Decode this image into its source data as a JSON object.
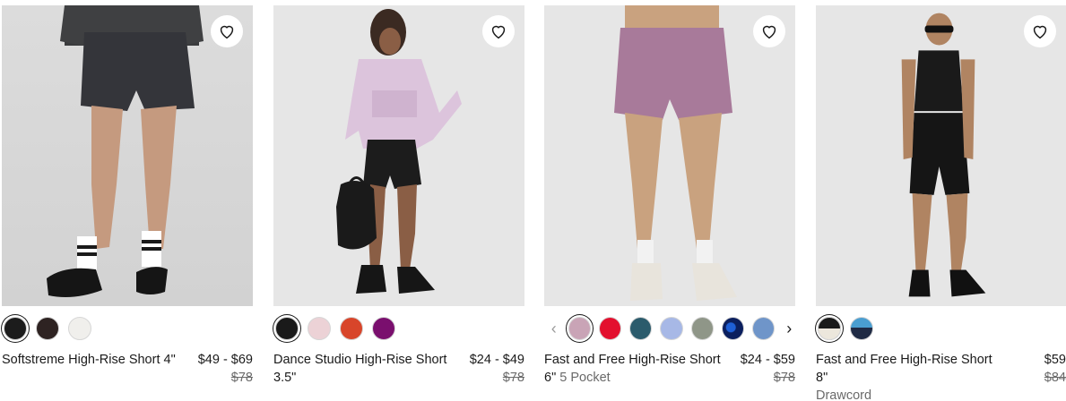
{
  "products": [
    {
      "name": "Softstreme High-Rise Short 4\"",
      "subtitle": "",
      "price": "$49 - $69",
      "original_price": "$78",
      "swatches": [
        "#1c1c1c",
        "#2e2322",
        "#f0efec"
      ],
      "selected_swatch": 0
    },
    {
      "name": "Dance Studio High-Rise Short 3.5\"",
      "subtitle": "",
      "price": "$24 - $49",
      "original_price": "$78",
      "swatches": [
        "#1a1a1a",
        "#ecd2d6",
        "#d8452a",
        "#7a0f6e"
      ],
      "selected_swatch": 0
    },
    {
      "name": "Fast and Free High-Rise Short 6\"",
      "subtitle": "5 Pocket",
      "price": "$24 - $59",
      "original_price": "$78",
      "swatches": [
        "#c9a4b6",
        "#e3102e",
        "#2b5b6c",
        "#a7b8e6",
        "#8f9688",
        "pattern",
        "#6f95c9"
      ],
      "selected_swatch": 0,
      "prev_arrow": "‹",
      "next_arrow": "›"
    },
    {
      "name": "Fast and Free High-Rise Short 8\"",
      "subtitle": "Drawcord",
      "price": "$59",
      "original_price": "$84",
      "swatches": [
        "half-black-cream",
        "half-blue-navy"
      ],
      "selected_swatch": 0
    }
  ],
  "icons": {
    "wishlist": "heart-outline-icon",
    "prev": "chevron-left-icon",
    "next": "chevron-right-icon"
  }
}
